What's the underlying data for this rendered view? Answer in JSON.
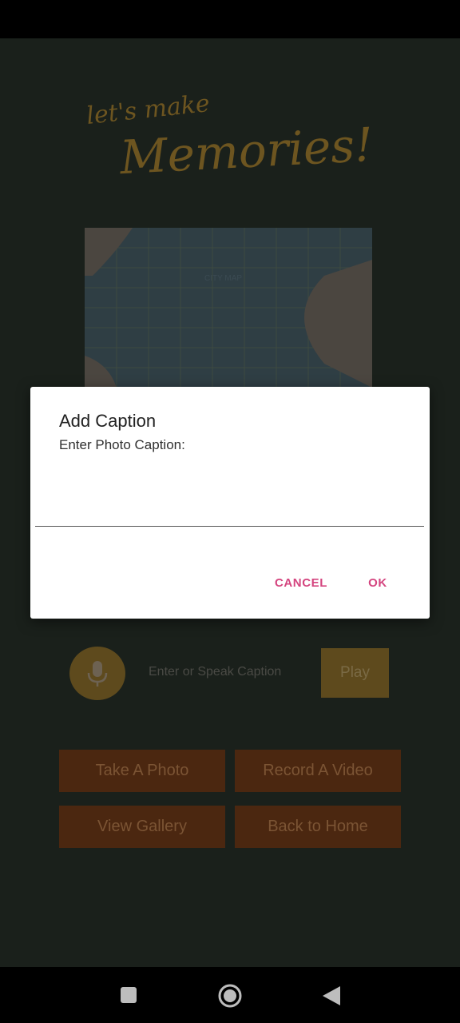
{
  "background": {
    "title_small": "let's make",
    "title_big": "Memories!",
    "map_label": "CITY MAP",
    "caption_placeholder": "Enter or Speak Caption",
    "play_label": "Play",
    "buttons": {
      "take_photo": "Take A Photo",
      "record_video": "Record A Video",
      "view_gallery": "View Gallery",
      "back_home": "Back to Home"
    }
  },
  "dialog": {
    "title": "Add Caption",
    "message": "Enter Photo Caption:",
    "input_value": "",
    "cancel_label": "CANCEL",
    "ok_label": "OK"
  },
  "colors": {
    "accent_pink": "#d4457f",
    "button_brown": "#4b2710",
    "gold": "#5e4a1d",
    "scrim_bg": "#1a201b"
  },
  "icons": {
    "mic": "microphone-icon",
    "nav_recent": "recent-apps-icon",
    "nav_home": "home-icon",
    "nav_back": "back-icon"
  }
}
